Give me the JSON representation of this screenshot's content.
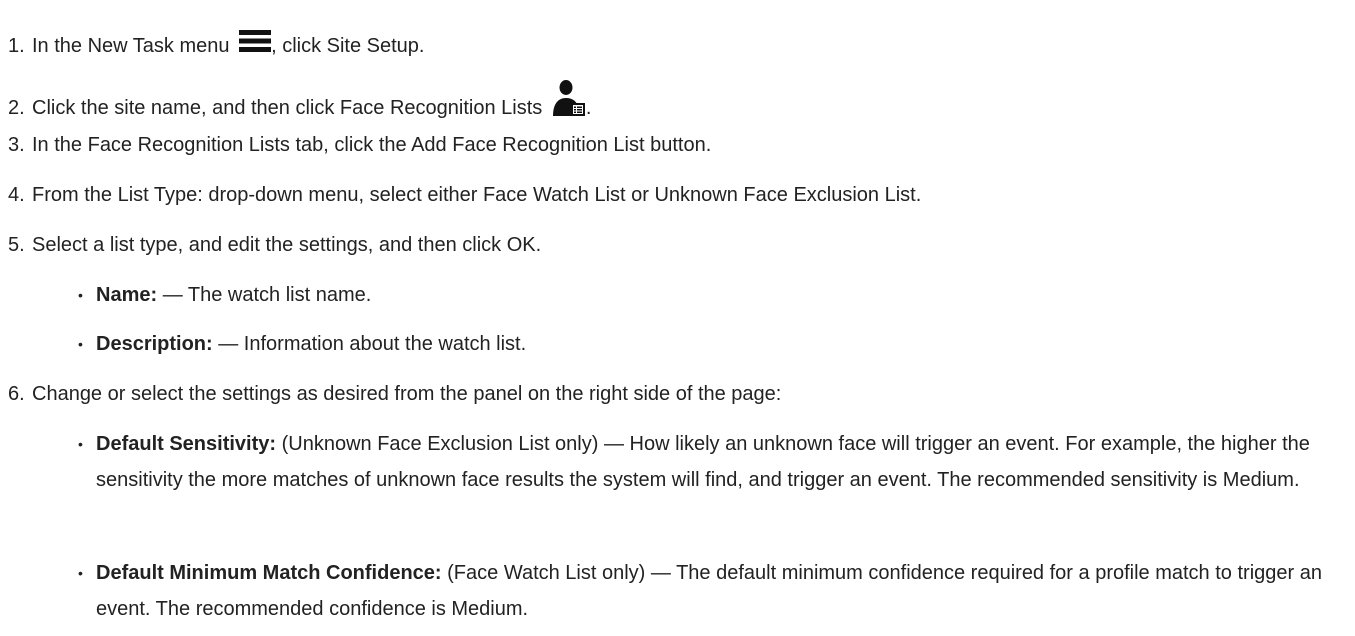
{
  "steps": [
    {
      "num": "1.",
      "before": "In the New Task menu ",
      "icon": "hamburger-menu-icon",
      "after": ", click Site Setup."
    },
    {
      "num": "2.",
      "before": "Click the site name, and then click Face Recognition Lists ",
      "icon": "face-recognition-list-icon",
      "after": "."
    },
    {
      "num": "3.",
      "text": "In the Face Recognition Lists tab, click the Add Face Recognition List button."
    },
    {
      "num": "4.",
      "text": "From the List Type: drop-down menu, select either Face Watch List or Unknown Face Exclusion List."
    },
    {
      "num": "5.",
      "text": "Select a list type, and edit the settings, and then click OK."
    },
    {
      "num": "6.",
      "text": "Change or select the settings as desired from the panel on the right side of the page:"
    }
  ],
  "step5_bullets": [
    {
      "term": "Name:",
      "desc": " — The watch list name."
    },
    {
      "term": "Description:",
      "desc": " — Information about the watch list."
    }
  ],
  "step6_bullets": [
    {
      "term": "Default Sensitivity:",
      "desc": " (Unknown Face Exclusion List only) — How likely an unknown face will trigger an event. For example, the higher the sensitivity the more matches of unknown face results the system will find, and trigger an event. The recommended sensitivity is Medium."
    },
    {
      "term": "Default Minimum Match Confidence:",
      "desc": " (Face Watch List only) — The default minimum confidence required for a profile match to trigger an event. The recommended confidence is Medium."
    }
  ]
}
